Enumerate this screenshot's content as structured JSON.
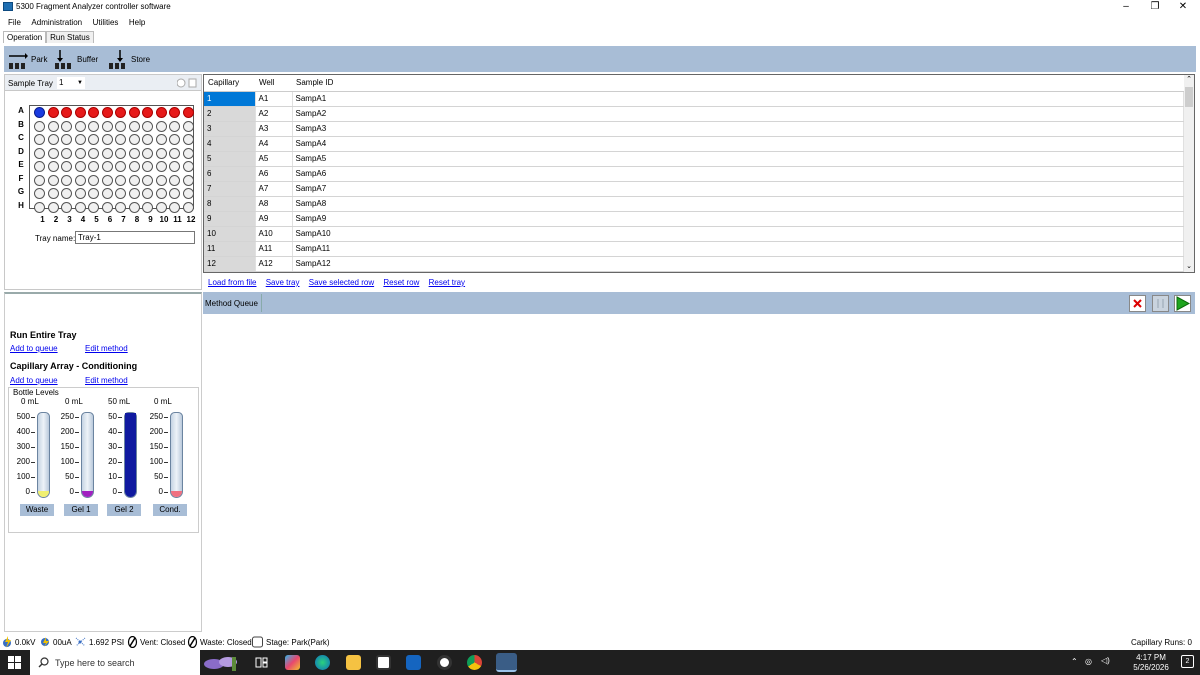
{
  "window": {
    "title": "5300 Fragment Analyzer controller software",
    "minimize": "–",
    "restore": "❐",
    "close": "✕"
  },
  "menu": [
    "File",
    "Administration",
    "Utilities",
    "Help"
  ],
  "tabs": [
    {
      "label": "Operation",
      "active": true
    },
    {
      "label": "Run Status",
      "active": false
    }
  ],
  "toolbar": {
    "park": "Park",
    "buffer": "Buffer",
    "store": "Store"
  },
  "tray": {
    "label": "Sample Tray",
    "selected": "1",
    "rows": [
      "A",
      "B",
      "C",
      "D",
      "E",
      "F",
      "G",
      "H"
    ],
    "cols": [
      "1",
      "2",
      "3",
      "4",
      "5",
      "6",
      "7",
      "8",
      "9",
      "10",
      "11",
      "12"
    ],
    "row_a_state": [
      "blue",
      "red",
      "red",
      "red",
      "red",
      "red",
      "red",
      "red",
      "red",
      "red",
      "red",
      "red"
    ],
    "tray_name_label": "Tray name:",
    "tray_name_value": "Tray-1"
  },
  "sample_table": {
    "headers": [
      "Capillary",
      "Well",
      "Sample ID"
    ],
    "rows": [
      [
        "1",
        "A1",
        "SampA1"
      ],
      [
        "2",
        "A2",
        "SampA2"
      ],
      [
        "3",
        "A3",
        "SampA3"
      ],
      [
        "4",
        "A4",
        "SampA4"
      ],
      [
        "5",
        "A5",
        "SampA5"
      ],
      [
        "6",
        "A6",
        "SampA6"
      ],
      [
        "7",
        "A7",
        "SampA7"
      ],
      [
        "8",
        "A8",
        "SampA8"
      ],
      [
        "9",
        "A9",
        "SampA9"
      ],
      [
        "10",
        "A10",
        "SampA10"
      ],
      [
        "11",
        "A11",
        "SampA11"
      ],
      [
        "12",
        "A12",
        "SampA12"
      ]
    ],
    "selected_row": 0
  },
  "table_links": [
    "Load from file",
    "Save tray",
    "Save selected row",
    "Reset row",
    "Reset tray"
  ],
  "method_queue": {
    "label": "Method Queue"
  },
  "methods": {
    "run_entire_tray": "Run Entire Tray",
    "capillary_conditioning": "Capillary Array - Conditioning",
    "add_to_queue": "Add to queue",
    "edit_method": "Edit method"
  },
  "bottles": {
    "title": "Bottle Levels",
    "items": [
      {
        "name": "Waste",
        "level": "0 mL",
        "ticks": [
          "500",
          "400",
          "300",
          "200",
          "100",
          "0"
        ],
        "fill": 0.04,
        "color": "#f0f070"
      },
      {
        "name": "Gel 1",
        "level": "0 mL",
        "ticks": [
          "250",
          "200",
          "150",
          "100",
          "50",
          "0"
        ],
        "fill": 0.04,
        "color": "#a020c0"
      },
      {
        "name": "Gel 2",
        "level": "50 mL",
        "ticks": [
          "50",
          "40",
          "30",
          "20",
          "10",
          "0"
        ],
        "fill": 1.0,
        "color": "#101aa0"
      },
      {
        "name": "Cond.",
        "level": "0 mL",
        "ticks": [
          "250",
          "200",
          "150",
          "100",
          "50",
          "0"
        ],
        "fill": 0.04,
        "color": "#f07080"
      }
    ]
  },
  "status": {
    "voltage": "0.0kV",
    "current": "00uA",
    "pressure": "1.692 PSI",
    "vent": "Vent: Closed",
    "waste": "Waste: Closed",
    "stage": "Stage: Park(Park)",
    "capillary_runs": "Capillary Runs: 0"
  },
  "taskbar": {
    "search_placeholder": "Type here to search",
    "time": "4:17 PM",
    "date": "5/26/2026",
    "notifications": "2"
  }
}
